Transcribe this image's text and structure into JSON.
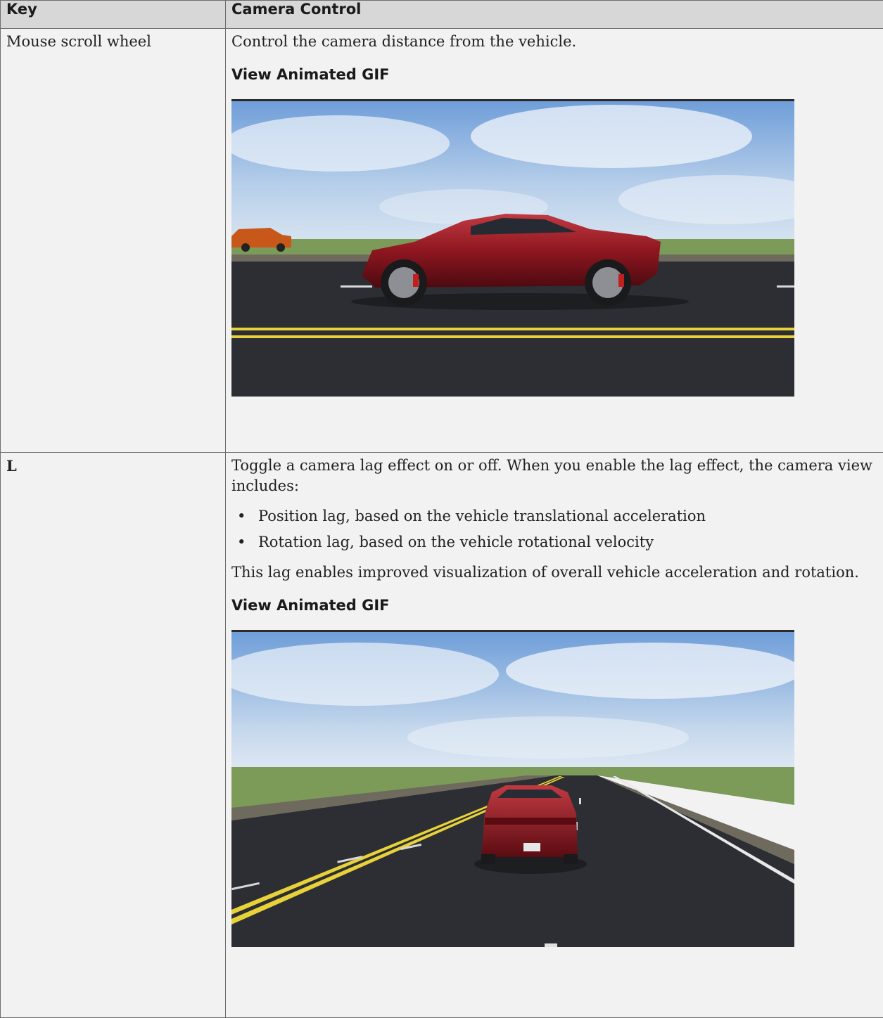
{
  "table": {
    "headers": {
      "key": "Key",
      "camera_control": "Camera Control"
    },
    "rows": [
      {
        "key": "Mouse scroll wheel",
        "description": "Control the camera distance from the vehicle.",
        "gif_link": "View Animated GIF"
      },
      {
        "key": "L",
        "description": "Toggle a camera lag effect on or off. When you enable the lag effect, the camera view includes:",
        "bullets": [
          "Position lag, based on the vehicle translational acceleration",
          "Rotation lag, based on the vehicle rotational velocity"
        ],
        "followup": "This lag enables improved visualization of overall vehicle acceleration and rotation.",
        "gif_link": "View Animated GIF"
      }
    ]
  },
  "colors": {
    "header_bg": "#d7d7d7",
    "cell_bg": "#f2f2f2",
    "border": "#6e6e6e",
    "road_line": "#e8d23a",
    "car_body": "#8e1620"
  }
}
